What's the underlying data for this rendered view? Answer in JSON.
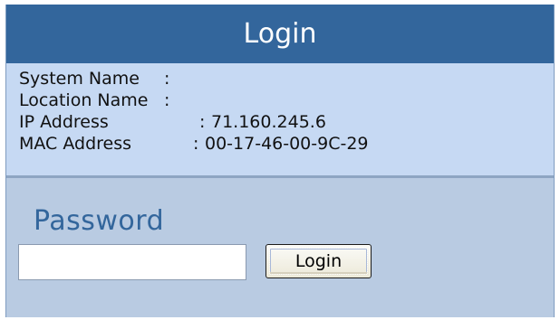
{
  "header": {
    "title": "Login"
  },
  "system_info": {
    "rows": [
      {
        "label": "System Name",
        "separator": ":",
        "value": ""
      },
      {
        "label": "Location Name",
        "separator": ":",
        "value": ""
      },
      {
        "label": "IP Address",
        "separator": ":",
        "value": "71.160.245.6"
      },
      {
        "label": "MAC Address",
        "separator": ":",
        "value": "00-17-46-00-9C-29"
      }
    ]
  },
  "login_form": {
    "password_label": "Password",
    "password_value": "",
    "submit_label": "Login"
  },
  "colors": {
    "header_bg": "#33669c",
    "info_bg": "#c6d9f3",
    "form_bg": "#b9cbe2",
    "label_accent": "#33669c"
  }
}
